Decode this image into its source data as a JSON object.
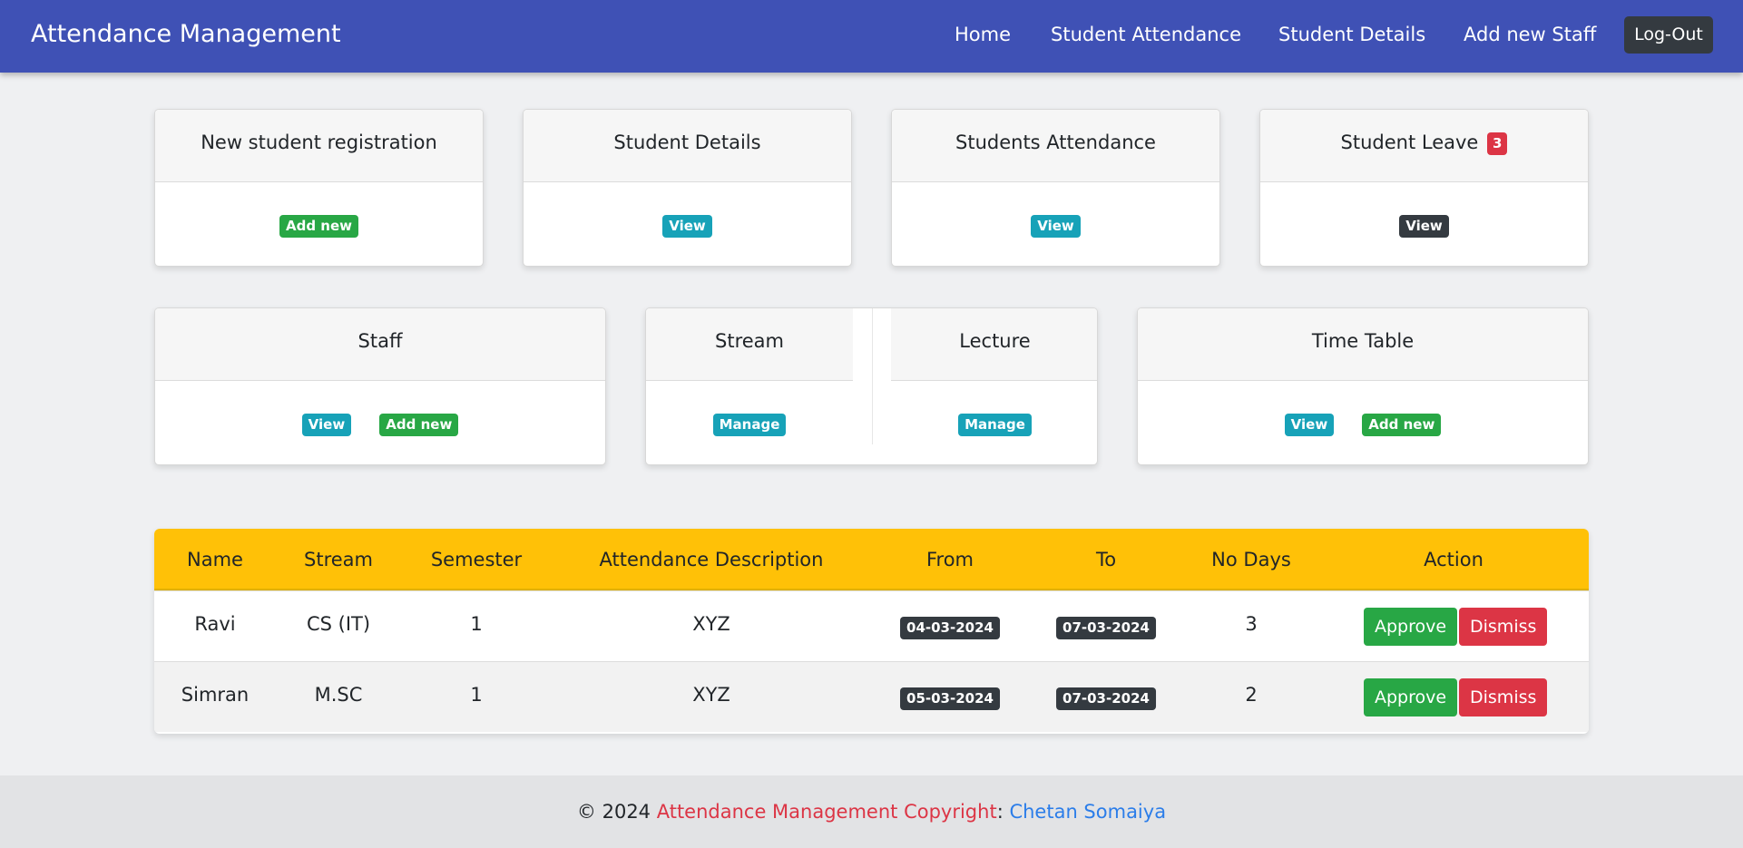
{
  "navbar": {
    "brand": "Attendance Management",
    "links": [
      "Home",
      "Student Attendance",
      "Student Details",
      "Add new Staff"
    ],
    "logout": "Log-Out"
  },
  "cards_row1": [
    {
      "title": "New student registration",
      "button": "Add new",
      "color": "#28a745"
    },
    {
      "title": "Student Details",
      "button": "View",
      "color": "#17a2b8"
    },
    {
      "title": "Students Attendance",
      "button": "View",
      "color": "#17a2b8"
    },
    {
      "title": "Student Leave",
      "count": "3",
      "button": "View",
      "color": "#343a40"
    }
  ],
  "cards_row2": {
    "staff": {
      "title": "Staff",
      "view": "View",
      "add": "Add new"
    },
    "stream": {
      "title": "Stream",
      "button": "Manage"
    },
    "lecture": {
      "title": "Lecture",
      "button": "Manage"
    },
    "timetable": {
      "title": "Time Table",
      "view": "View",
      "add": "Add new"
    }
  },
  "table": {
    "headers": [
      "Name",
      "Stream",
      "Semester",
      "Attendance Description",
      "From",
      "To",
      "No Days",
      "Action"
    ],
    "rows": [
      {
        "name": "Ravi",
        "stream": "CS (IT)",
        "semester": "1",
        "description": "XYZ",
        "from": "04-03-2024",
        "to": "07-03-2024",
        "days": "3",
        "approve": "Approve",
        "dismiss": "Dismiss"
      },
      {
        "name": "Simran",
        "stream": "M.SC",
        "semester": "1",
        "description": "XYZ",
        "from": "05-03-2024",
        "to": "07-03-2024",
        "days": "2",
        "approve": "Approve",
        "dismiss": "Dismiss"
      }
    ]
  },
  "footer": {
    "prefix": "© 2024 ",
    "copyright": "Attendance Management Copyright",
    "sep": ": ",
    "author": "Chetan Somaiya"
  },
  "colors": {
    "navbar": "#3f51b5",
    "table_header": "#ffc107",
    "success": "#28a745",
    "info": "#17a2b8",
    "danger": "#dc3545",
    "dark": "#343a40"
  }
}
